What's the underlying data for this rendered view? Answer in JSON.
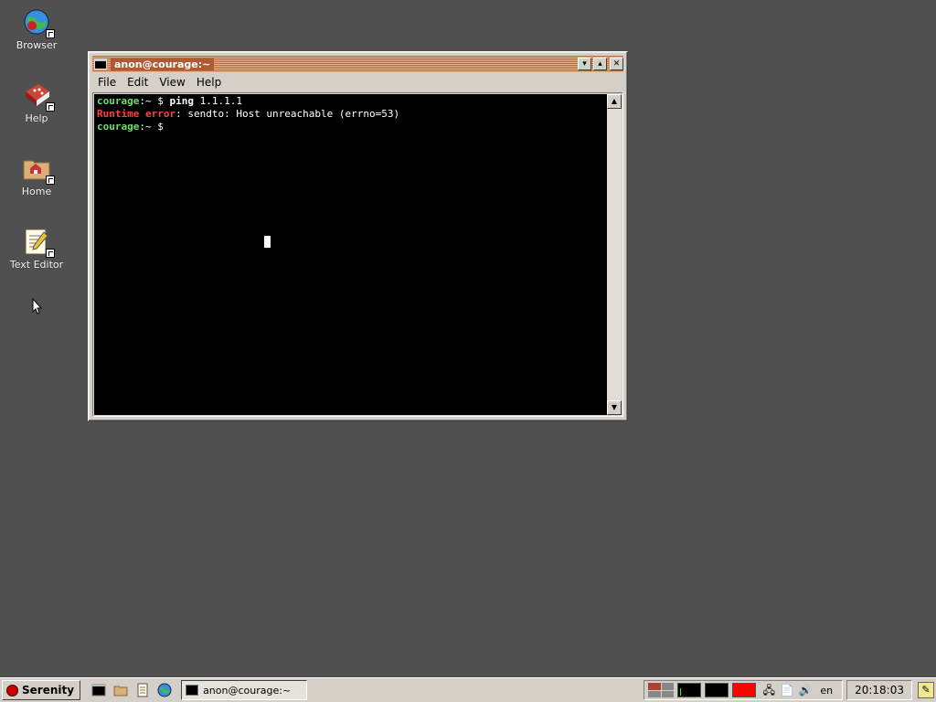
{
  "desktop": {
    "icons": [
      {
        "label": "Browser",
        "icon": "globe-icon"
      },
      {
        "label": "Help",
        "icon": "book-icon"
      },
      {
        "label": "Home",
        "icon": "home-folder-icon"
      },
      {
        "label": "Text Editor",
        "icon": "notepad-icon"
      }
    ]
  },
  "window": {
    "title": "anon@courage:~",
    "buttons": {
      "minimize": "▾",
      "maximize": "▴",
      "close": "✕"
    },
    "menu": [
      "File",
      "Edit",
      "View",
      "Help"
    ],
    "terminal": {
      "line1": {
        "host": "courage",
        "path": ":~ $ ",
        "command": "ping",
        "args": " 1.1.1.1"
      },
      "line2": {
        "error_label": "Runtime error",
        "message": ": sendto: Host unreachable (errno=53)"
      },
      "line3": {
        "host": "courage",
        "path": ":~ $"
      }
    }
  },
  "taskbar": {
    "start_label": "Serenity",
    "task_title": "anon@courage:~",
    "lang": "en",
    "clock": "20:18:03"
  },
  "colors": {
    "desktop": "#505050",
    "prompt_host": "#6fdc6f",
    "error": "#ff4040",
    "title_active": "#c46a3a"
  }
}
